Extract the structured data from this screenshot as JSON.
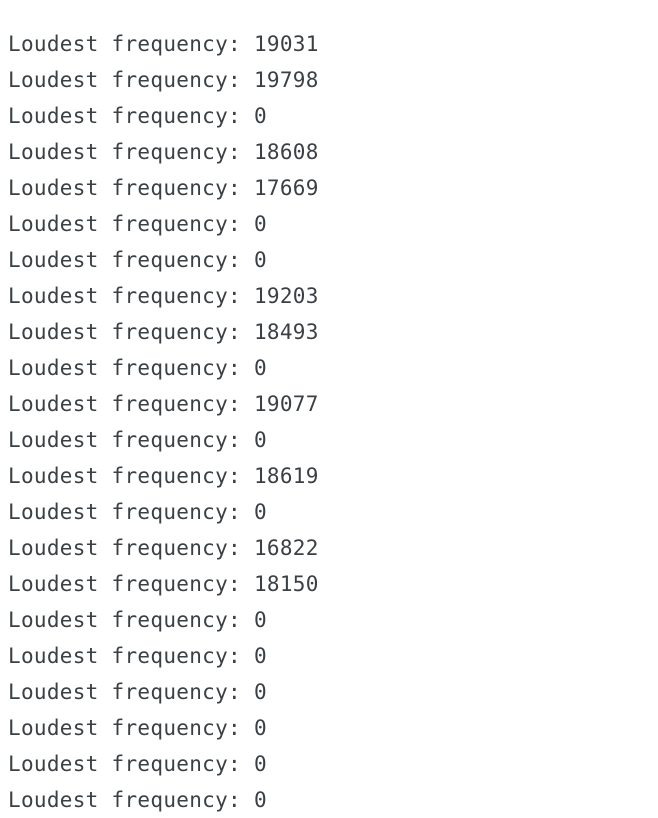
{
  "console": {
    "prefix": "Loudest frequency:",
    "lines": [
      "19031",
      "19798",
      "0",
      "18608",
      "17669",
      "0",
      "0",
      "19203",
      "18493",
      "0",
      "19077",
      "0",
      "18619",
      "0",
      "16822",
      "18150",
      "0",
      "0",
      "0",
      "0",
      "0",
      "0"
    ]
  }
}
